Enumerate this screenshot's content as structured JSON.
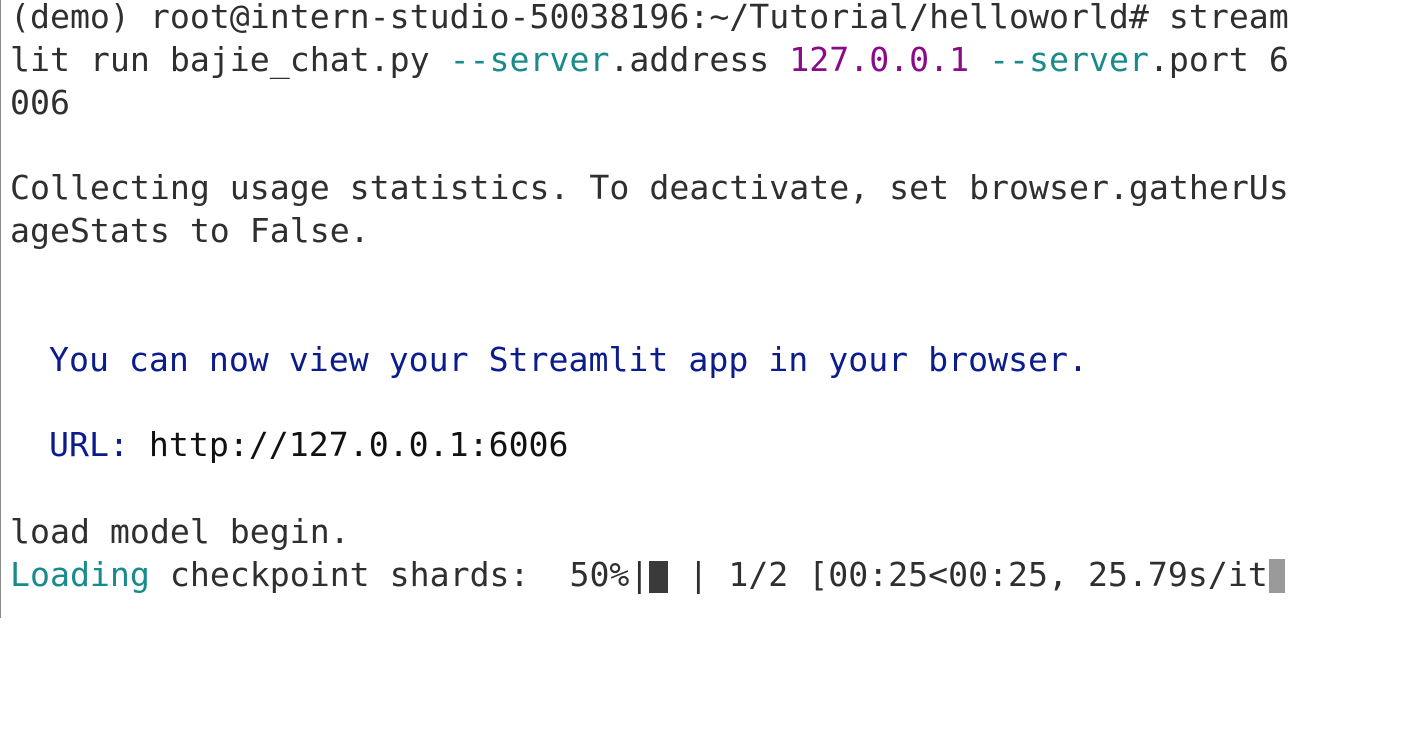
{
  "terminal": {
    "prompt": "(demo) root@intern-studio-50038196:~/Tutorial/helloworld#",
    "command_part1": " stream",
    "command_line2_a": "lit run bajie_chat.py ",
    "flag_server_1": "--server",
    "flag_address": ".address ",
    "address_value": "127.0.0.1",
    "space": " ",
    "flag_server_2": "--server",
    "flag_port": ".port 6",
    "command_line3": "006",
    "stats_line1": "Collecting usage statistics. To deactivate, set browser.gatherUs",
    "stats_line2": "ageStats to False.",
    "view_message": "You can now view your Streamlit app in your browser.",
    "url_label": "URL:",
    "url_value": " http://127.0.0.1:6006",
    "load_message": "load model begin.",
    "loading_label": "Loading",
    "loading_rest": " checkpoint shards:  50%|",
    "progress_after": " | 1/2 [00:25<00:25, 25.79s/it",
    "progress_fraction": 0.5
  },
  "colors": {
    "default_text": "#3a3a3a",
    "flag": "#1a8a8a",
    "ip_value": "#8a0a8a",
    "streamlit_message": "#0b1c8c",
    "url": "#111111",
    "cursor": "#9a9a9a"
  }
}
